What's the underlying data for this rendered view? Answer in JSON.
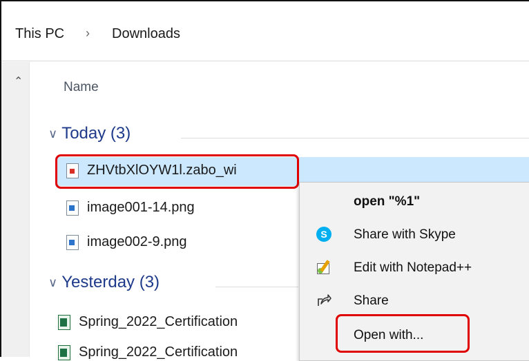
{
  "breadcrumb": {
    "root": "This PC",
    "separator": "›",
    "current": "Downloads"
  },
  "column_header": {
    "name": "Name"
  },
  "groups": [
    {
      "label": "Today (3)",
      "files": [
        {
          "name": "ZHVtbXlOYW1l.zabo_wi",
          "icon": "zabo-file-icon",
          "selected": true
        },
        {
          "name": "image001-14.png",
          "icon": "png-file-icon"
        },
        {
          "name": "image002-9.png",
          "icon": "png-file-icon"
        }
      ]
    },
    {
      "label": "Yesterday (3)",
      "files": [
        {
          "name": "Spring_2022_Certification",
          "icon": "excel-file-icon"
        },
        {
          "name": "Spring_2022_Certification",
          "icon": "excel-file-icon"
        }
      ]
    }
  ],
  "context_menu": {
    "items": [
      {
        "label": "open \"%1\"",
        "bold": true,
        "icon": ""
      },
      {
        "label": "Share with Skype",
        "icon": "skype-icon"
      },
      {
        "label": "Edit with Notepad++",
        "icon": "notepadpp-icon"
      },
      {
        "label": "Share",
        "icon": "share-icon"
      },
      {
        "label": "Open with...",
        "icon": "",
        "highlighted": true
      }
    ]
  },
  "colors": {
    "selection": "#cce8ff",
    "group_header": "#1e3a8a",
    "annotation": "#e00000"
  }
}
